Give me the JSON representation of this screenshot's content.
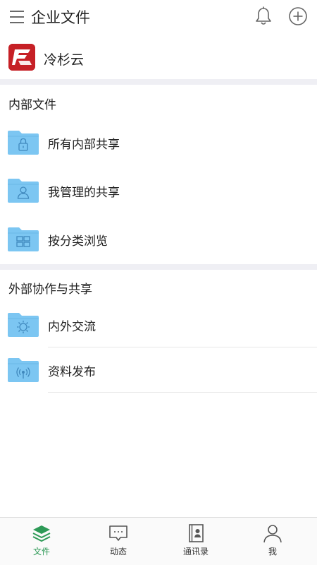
{
  "header": {
    "title": "企业文件",
    "menu_icon": "hamburger-menu-icon",
    "bell_icon": "notification-bell-icon",
    "add_icon": "plus-circle-icon"
  },
  "company": {
    "name": "冷杉云",
    "logo_icon": "fir-cloud-logo",
    "logo_color": "#c62026"
  },
  "internal": {
    "title": "内部文件",
    "items": [
      {
        "label": "所有内部共享",
        "icon": "folder-lock-icon"
      },
      {
        "label": "我管理的共享",
        "icon": "folder-user-icon"
      },
      {
        "label": "按分类浏览",
        "icon": "folder-grid-icon"
      }
    ]
  },
  "external": {
    "title": "外部协作与共享",
    "items": [
      {
        "label": "内外交流",
        "icon": "folder-exchange-icon"
      },
      {
        "label": "资料发布",
        "icon": "folder-broadcast-icon"
      }
    ]
  },
  "tabs": [
    {
      "label": "文件",
      "icon": "layers-icon",
      "active": true
    },
    {
      "label": "动态",
      "icon": "chat-bubble-icon",
      "active": false
    },
    {
      "label": "通讯录",
      "icon": "contacts-book-icon",
      "active": false
    },
    {
      "label": "我",
      "icon": "person-icon",
      "active": false
    }
  ],
  "colors": {
    "accent": "#2e9a57",
    "folder": "#7cc6f2",
    "section_bg": "#efeff4"
  }
}
